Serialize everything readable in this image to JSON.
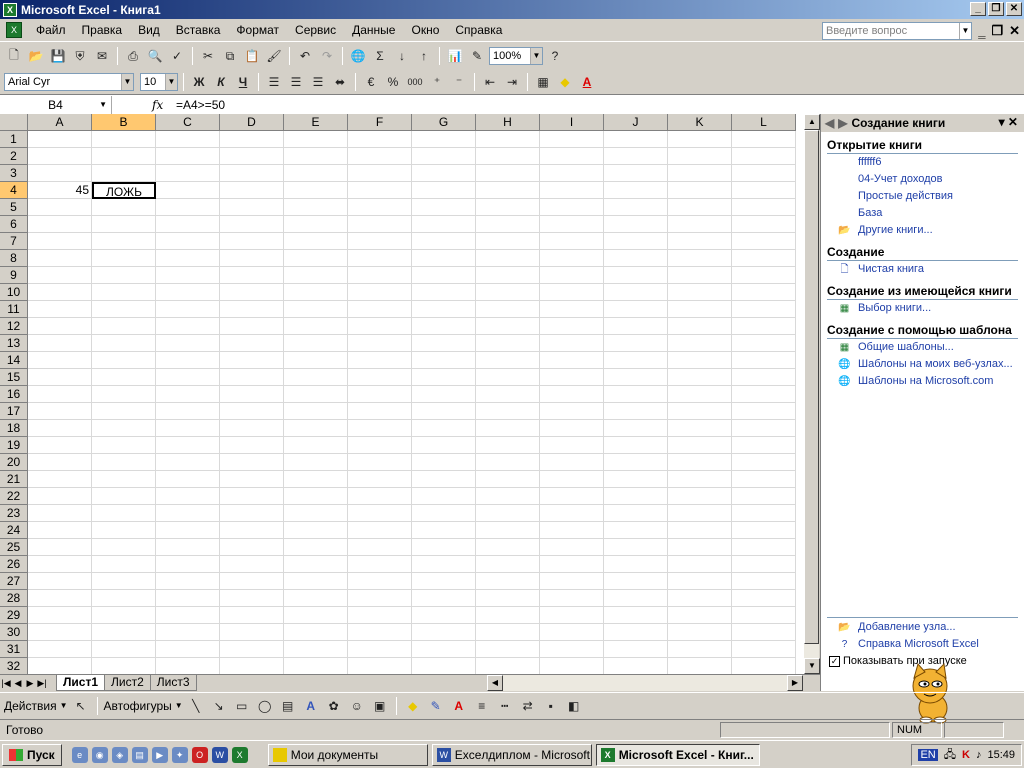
{
  "window": {
    "title": "Microsoft Excel - Книга1"
  },
  "menu": [
    "Файл",
    "Правка",
    "Вид",
    "Вставка",
    "Формат",
    "Сервис",
    "Данные",
    "Окно",
    "Справка"
  ],
  "ask_placeholder": "Введите вопрос",
  "toolbar": {
    "zoom": "100%",
    "font": "Arial Cyr",
    "size": "10",
    "bold": "Ж",
    "italic": "К",
    "underline": "Ч",
    "percent": "%",
    "thousands": "000"
  },
  "formula_bar": {
    "name_box": "B4",
    "fx": "fx",
    "formula": "=A4>=50"
  },
  "columns": [
    "A",
    "B",
    "C",
    "D",
    "E",
    "F",
    "G",
    "H",
    "I",
    "J",
    "K",
    "L"
  ],
  "rows": [
    "1",
    "2",
    "3",
    "4",
    "5",
    "6",
    "7",
    "8",
    "9",
    "10",
    "11",
    "12",
    "13",
    "14",
    "15",
    "16",
    "17",
    "18",
    "19",
    "20",
    "21",
    "22",
    "23",
    "24",
    "25",
    "26",
    "27",
    "28",
    "29",
    "30",
    "31",
    "32"
  ],
  "cells": {
    "A4": "45",
    "B4": "ЛОЖЬ"
  },
  "sheets": [
    "Лист1",
    "Лист2",
    "Лист3"
  ],
  "active_sheet": "Лист1",
  "drawing": {
    "actions": "Действия",
    "autoshapes": "Автофигуры"
  },
  "status": {
    "text": "Готово",
    "num": "NUM"
  },
  "taskpane": {
    "title": "Создание книги",
    "open_section": "Открытие книги",
    "recent": [
      "ffffff6",
      "04-Учет доходов",
      "Простые действия",
      "База"
    ],
    "other_books": "Другие книги...",
    "create_section": "Создание",
    "blank": "Чистая книга",
    "from_existing_section": "Создание из имеющейся книги",
    "choose_book": "Выбор книги...",
    "template_section": "Создание с помощью шаблона",
    "templates": [
      "Общие шаблоны...",
      "Шаблоны на моих веб-узлах...",
      "Шаблоны на Microsoft.com"
    ],
    "add_node": "Добавление узла...",
    "help": "Справка Microsoft Excel",
    "show_startup": "Показывать при запуске"
  },
  "taskbar": {
    "start": "Пуск",
    "buttons": [
      "Мои документы",
      "Exceлдиплом - Microsoft...",
      "Microsoft Excel - Книг..."
    ],
    "clock": "15:49",
    "lang": "EN"
  }
}
